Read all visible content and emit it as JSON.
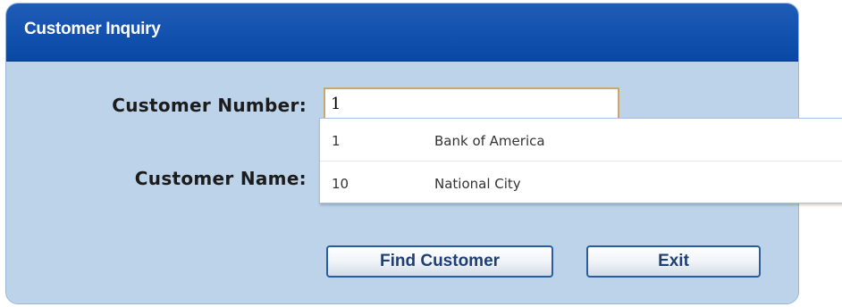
{
  "panel": {
    "title": "Customer Inquiry"
  },
  "form": {
    "customer_number_label": "Customer Number:",
    "customer_number_value": "1",
    "customer_name_label": "Customer Name:"
  },
  "suggestions": [
    {
      "number": "1",
      "name": "Bank of America"
    },
    {
      "number": "10",
      "name": "National City"
    }
  ],
  "buttons": {
    "find_label": "Find Customer",
    "exit_label": "Exit"
  },
  "colors": {
    "header_blue": "#0a48a6",
    "panel_bg": "#bcd3ea",
    "input_border": "#c8a96b",
    "button_text": "#1d3f73"
  }
}
